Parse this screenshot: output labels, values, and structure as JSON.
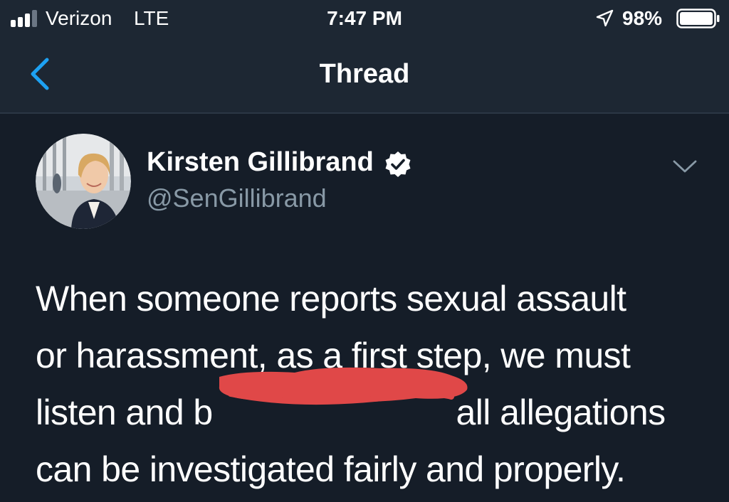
{
  "status_bar": {
    "carrier": "Verizon",
    "network": "LTE",
    "time": "7:47 PM",
    "battery_percent": "98%",
    "icons": [
      "signal-icon",
      "location-arrow-icon",
      "battery-icon"
    ]
  },
  "nav": {
    "back_icon": "chevron-left-icon",
    "title": "Thread"
  },
  "tweet": {
    "display_name": "Kirsten Gillibrand",
    "handle": "@SenGillibrand",
    "verified_icon": "verified-badge-icon",
    "menu_icon": "chevron-down-icon",
    "text_lines": [
      "When someone reports sexual assault",
      "or harassment, as a first step, we must",
      "listen and b",
      "all allegations",
      "can be investigated fairly and properly."
    ]
  },
  "colors": {
    "background": "#151d28",
    "bar_background": "#1d2733",
    "accent": "#1da1f2",
    "secondary_text": "#8899a6",
    "redaction": "#e04848"
  }
}
